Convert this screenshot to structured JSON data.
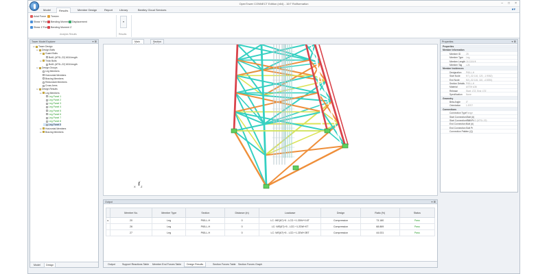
{
  "window": {
    "title": "OpenTower CONNECT Edition (x64) - 10/7 Rollformation"
  },
  "tabs": [
    "Model",
    "Results",
    "Member Design",
    "Report",
    "Library",
    "Bentley Cloud Services"
  ],
  "active_tab": "Results",
  "ribbon": {
    "col1": [
      "Axial Force",
      "Shear Y Force",
      "Shear Z Force"
    ],
    "col2": [
      "Torsion",
      "Bending Moment Y",
      "Bending Moment Z"
    ],
    "col3": [
      "Displacement"
    ],
    "group1_label": "Analysis Results",
    "group2_label": "Results"
  },
  "left_panel": {
    "title": "Tower Model Explorer",
    "tree": [
      {
        "label": "Tower Design",
        "level": 0,
        "type": "folder"
      },
      {
        "label": "Design Bolts",
        "level": 1,
        "type": "folder"
      },
      {
        "label": "Guard Bolts",
        "level": 2,
        "type": "folder"
      },
      {
        "label": "Bolt1 (ATSL-22) M16 length",
        "level": 3,
        "type": "box"
      },
      {
        "label": "Thick Bolts",
        "level": 2,
        "type": "folder"
      },
      {
        "label": "Bolt1 (ATSL-22) M16 length",
        "level": 3,
        "type": "box"
      },
      {
        "label": "Design Groups",
        "level": 1,
        "type": "folder"
      },
      {
        "label": "Leg Members",
        "level": 2,
        "type": "box"
      },
      {
        "label": "Horizontal Members",
        "level": 2,
        "type": "box"
      },
      {
        "label": "Bracing Members",
        "level": 2,
        "type": "box"
      },
      {
        "label": "Redundant Members",
        "level": 2,
        "type": "box"
      },
      {
        "label": "Cross Arms",
        "level": 2,
        "type": "box"
      },
      {
        "label": "Design Results",
        "level": 1,
        "type": "folder"
      },
      {
        "label": "Leg Members",
        "level": 2,
        "type": "folder"
      },
      {
        "label": "Leg Panel 1",
        "level": 3,
        "type": "box",
        "green": true
      },
      {
        "label": "Leg Panel 2",
        "level": 3,
        "type": "box",
        "green": true
      },
      {
        "label": "Leg Panel 3",
        "level": 3,
        "type": "box",
        "green": true
      },
      {
        "label": "Leg Panel 4",
        "level": 3,
        "type": "box",
        "green": true
      },
      {
        "label": "Leg Panel 5",
        "level": 3,
        "type": "box",
        "green": true
      },
      {
        "label": "Leg Panel 6",
        "level": 3,
        "type": "box",
        "green": true
      },
      {
        "label": "Leg Panel 7",
        "level": 3,
        "type": "box",
        "green": true
      },
      {
        "label": "Leg Panel 8",
        "level": 3,
        "type": "box",
        "green": true
      },
      {
        "label": "Leg Panel 9",
        "level": 3,
        "type": "box",
        "selected": true
      },
      {
        "label": "Horizontal Members",
        "level": 2,
        "type": "folder"
      },
      {
        "label": "Bracing Members",
        "level": 2,
        "type": "folder"
      }
    ],
    "bottom_tabs": [
      "Model",
      "Design"
    ],
    "active_bottom_tab": "Design"
  },
  "view_tabs": [
    "Main Model",
    "Section Detail"
  ],
  "active_view_tab": "Main Model",
  "axis_labels": {
    "y": "Y",
    "x": "X",
    "z": "Z"
  },
  "right_panel": {
    "title": "Properties",
    "rows": [
      {
        "key": "Properties",
        "cat": true
      },
      {
        "key": "Member Information",
        "cat": true
      },
      {
        "key": "Member ID",
        "val": "25"
      },
      {
        "key": "Member Type",
        "val": "Leg"
      },
      {
        "key": "Member Length",
        "val": "16.1104 ft"
      },
      {
        "key": "Member Tag",
        "val": "L26"
      },
      {
        "key": "Member Incidences",
        "cat": true
      },
      {
        "key": "Designation",
        "val": "P65-L-H"
      },
      {
        "key": "Start Node",
        "val": "N7 (-32.116, 120, -1.9062)"
      },
      {
        "key": "End Node",
        "val": "N3 (-32.116, 110, -4.5391)"
      },
      {
        "key": "Section Details",
        "val": "P65-L-H"
      },
      {
        "key": "Material",
        "val": "ASTM A36"
      },
      {
        "key": "Release",
        "val": "Start: LTZ, End: LTZ"
      },
      {
        "key": "Specification",
        "val": "None"
      },
      {
        "key": "Geometry",
        "cat": true
      },
      {
        "key": "Beta Angle",
        "val": "0°"
      },
      {
        "key": "Orientation",
        "val": "1.5707"
      },
      {
        "key": "Connections",
        "cat": true
      },
      {
        "key": "Connection Type",
        "val": "Flange"
      },
      {
        "key": "Start Connection Bolt (#)",
        "val": "0"
      },
      {
        "key": "Start Connection Bolt Pr",
        "val": "ASTM 1/2 (ATSL-22)"
      },
      {
        "key": "End Connection Bolt (#)",
        "val": "0"
      },
      {
        "key": "End Connection Bolt Pr",
        "val": ""
      },
      {
        "key": "Connection Pattern (Q)",
        "val": "1"
      }
    ]
  },
  "output_panel": {
    "title": "Output",
    "columns": [
      "Member No.",
      "Member Type",
      "Section",
      "Distance (in)",
      "Loadcase",
      "Design",
      "Ratio (%)",
      "Status"
    ],
    "rows": [
      [
        "20",
        "Leg",
        "P65-L-H",
        "0",
        "LC: WE(67)+5 - LCD +1.2DW+0.6T",
        "Compression",
        "73.180",
        "Pass"
      ],
      [
        "26",
        "Leg",
        "P65-L-H",
        "0",
        "LC: WE(67)+5 - LCD +1.2DW+0T",
        "Compression",
        "68.869",
        "Pass"
      ],
      [
        "27",
        "Leg",
        "P65-L-H",
        "0",
        "LC: WE(67)+5 - LCD +1.2DW+2BT",
        "Compression",
        "44.031",
        "Pass"
      ]
    ],
    "tabs": [
      "Output",
      "Support Reactions Table",
      "Member End Forces Table",
      "Design Results",
      "Section Forces Table",
      "Section Forces Graph"
    ],
    "active_tab": "Design Results"
  },
  "colors": {
    "leg_red": "#d9434b",
    "cyan": "#35d0c2",
    "orange": "#ef8f3a",
    "yellow": "#dbe356",
    "node_green": "#5fcf5f"
  }
}
